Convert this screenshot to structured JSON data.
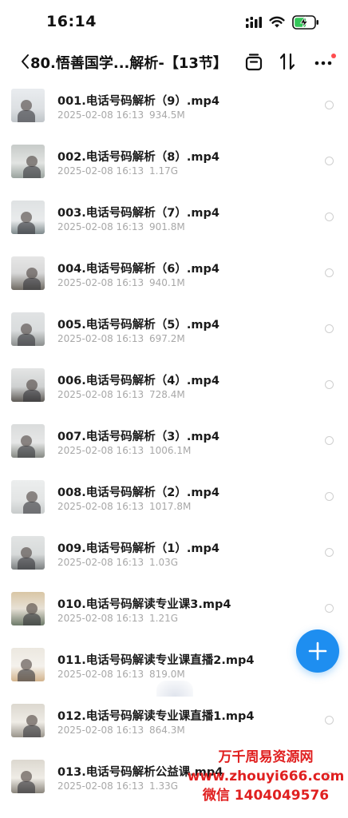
{
  "status_bar": {
    "time": "16:14"
  },
  "header": {
    "title": "80.悟善国学...解析-【13节】",
    "back_icon": "chevron-left-icon",
    "actions": [
      "tab-icon",
      "sort-icon",
      "more-icon"
    ],
    "more_badge_color": "#ff4d4f"
  },
  "files": [
    {
      "name": "001.电话号码解析（9）.mp4",
      "date": "2025-02-08 16:13",
      "size": "934.5M"
    },
    {
      "name": "002.电话号码解析（8）.mp4",
      "date": "2025-02-08 16:13",
      "size": "1.17G"
    },
    {
      "name": "003.电话号码解析（7）.mp4",
      "date": "2025-02-08 16:13",
      "size": "901.8M"
    },
    {
      "name": "004.电话号码解析（6）.mp4",
      "date": "2025-02-08 16:13",
      "size": "940.1M"
    },
    {
      "name": "005.电话号码解析（5）.mp4",
      "date": "2025-02-08 16:13",
      "size": "697.2M"
    },
    {
      "name": "006.电话号码解析（4）.mp4",
      "date": "2025-02-08 16:13",
      "size": "728.4M"
    },
    {
      "name": "007.电话号码解析（3）.mp4",
      "date": "2025-02-08 16:13",
      "size": "1006.1M"
    },
    {
      "name": "008.电话号码解析（2）.mp4",
      "date": "2025-02-08 16:13",
      "size": "1017.8M"
    },
    {
      "name": "009.电话号码解析（1）.mp4",
      "date": "2025-02-08 16:13",
      "size": "1.03G"
    },
    {
      "name": "010.电话号码解读专业课3.mp4",
      "date": "2025-02-08 16:13",
      "size": "1.21G"
    },
    {
      "name": "011.电话号码解读专业课直播2.mp4",
      "date": "2025-02-08 16:13",
      "size": "819.0M"
    },
    {
      "name": "012.电话号码解读专业课直播1.mp4",
      "date": "2025-02-08 16:13",
      "size": "864.3M"
    },
    {
      "name": "013.电话号码解析公益课.mp4",
      "date": "2025-02-08 16:13",
      "size": "1.33G"
    }
  ],
  "fab": {
    "icon": "plus-icon",
    "color": "#1e8ef0"
  },
  "watermark": {
    "line1": "万千周易资源网",
    "line2": "www.zhouyi666.com",
    "line3": "微信 1404049576",
    "color": "#e02020"
  }
}
